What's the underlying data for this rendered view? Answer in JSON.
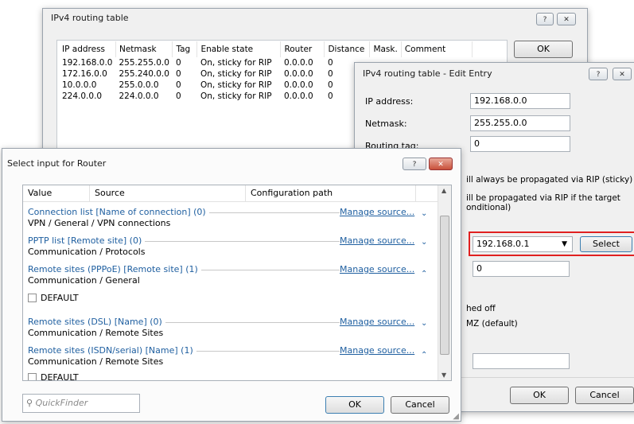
{
  "routing_window": {
    "title": "IPv4 routing table",
    "ok_label": "OK",
    "help_glyph": "?",
    "close_glyph": "✕",
    "columns": [
      "IP address",
      "Netmask",
      "Tag",
      "Enable state",
      "Router",
      "Distance",
      "Mask.",
      "Comment"
    ],
    "rows": [
      [
        "192.168.0.0",
        "255.255.0.0",
        "0",
        "On, sticky for RIP",
        "0.0.0.0",
        "0"
      ],
      [
        "172.16.0.0",
        "255.240.0.0",
        "0",
        "On, sticky for RIP",
        "0.0.0.0",
        "0"
      ],
      [
        "10.0.0.0",
        "255.0.0.0",
        "0",
        "On, sticky for RIP",
        "0.0.0.0",
        "0"
      ],
      [
        "224.0.0.0",
        "224.0.0.0",
        "0",
        "On, sticky for RIP",
        "0.0.0.0",
        "0"
      ]
    ]
  },
  "edit_window": {
    "title": "IPv4 routing table - Edit Entry",
    "help_glyph": "?",
    "ip_label": "IP address:",
    "ip_value": "192.168.0.0",
    "netmask_label": "Netmask:",
    "netmask_value": "255.255.0.0",
    "tag_label": "Routing tag:",
    "tag_value": "0",
    "option1_text": "ill always be propagated via RIP (sticky)",
    "option2_text_a": "ill be propagated via RIP if the target",
    "option2_text_b": "onditional)",
    "router_value": "192.168.0.1",
    "select_label": "Select",
    "distance_value": "0",
    "switched_off_text": "hed off",
    "dmz_text": "MZ (default)",
    "ok_label": "OK",
    "cancel_label": "Cancel"
  },
  "select_dialog": {
    "title": "Select input for Router",
    "help_glyph": "?",
    "close_glyph": "✕",
    "columns": [
      "Value",
      "Source",
      "Configuration path"
    ],
    "groups": [
      {
        "title": "Connection list [Name of connection] (0)",
        "path": "VPN / General / VPN connections",
        "manage": "Manage source...",
        "chevron": "⌄"
      },
      {
        "title": "PPTP list [Remote site] (0)",
        "path": "Communication / Protocols",
        "manage": "Manage source...",
        "chevron": "⌄"
      },
      {
        "title": "Remote sites (PPPoE) [Remote site] (1)",
        "path": "Communication / General",
        "manage": "Manage source...",
        "chevron": "⌃"
      },
      {
        "title": "Remote sites (DSL) [Name] (0)",
        "path": "Communication / Remote Sites",
        "manage": "Manage source...",
        "chevron": "⌄"
      },
      {
        "title": "Remote sites (ISDN/serial) [Name] (1)",
        "path": "Communication / Remote Sites",
        "manage": "Manage source...",
        "chevron": "⌃"
      }
    ],
    "default_label": "DEFAULT",
    "quickfinder_placeholder": "QuickFinder",
    "ok_label": "OK",
    "cancel_label": "Cancel"
  },
  "colors": {
    "link_blue": "#1f5fa0",
    "highlight_red": "#e02020",
    "dialog_bg": "#f0f0f0"
  }
}
